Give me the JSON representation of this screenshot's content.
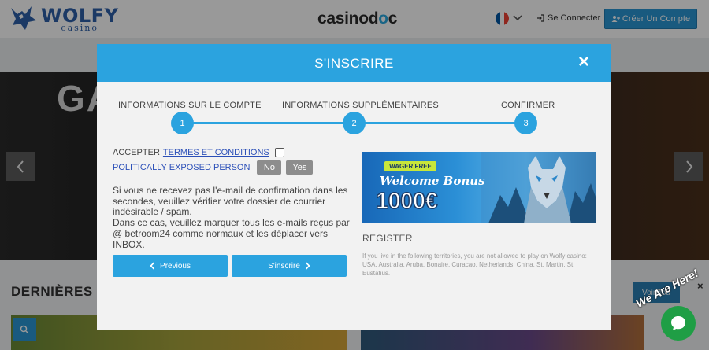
{
  "header": {
    "logo_main": "WOLFY",
    "logo_sub": "casino",
    "center_brand_left": "casino",
    "center_brand_mid": "d",
    "center_brand_dot": "o",
    "center_brand_right": "c",
    "language_flag_colors": [
      "#0055a4",
      "#ffffff",
      "#ef4135"
    ],
    "login_label": "Se Connecter",
    "register_label": "Créer Un Compte"
  },
  "background": {
    "hero_text": "GA",
    "section_title": "DERNIÈRES",
    "voir_label": "Voir Tou"
  },
  "modal": {
    "title": "S'INSCRIRE",
    "close_glyph": "×",
    "steps": [
      {
        "label": "INFORMATIONS SUR LE COMPTE",
        "number": "1"
      },
      {
        "label": "INFORMATIONS SUPPLÉMENTAIRES",
        "number": "2"
      },
      {
        "label": "CONFIRMER",
        "number": "3"
      }
    ],
    "accept_label": "ACCEPTER",
    "terms_link": "TERMES ET CONDITIONS",
    "pep_link": "POLITICALLY EXPOSED PERSON",
    "pep_no": "No",
    "pep_yes": "Yes",
    "info_text_1": "Si vous ne recevez pas l'e-mail de confirmation dans les secondes, veuillez vérifier votre dossier de courrier indésirable / spam.",
    "info_text_2": "Dans ce cas, veuillez marquer tous les e-mails reçus par @ betroom24 comme normaux et les déplacer vers INBOX.",
    "previous_label": "Previous",
    "signup_label": "S'inscrire",
    "banner": {
      "wager_label": "WAGER FREE",
      "welcome_label": "Welcome Bonus",
      "amount_label": "1000€"
    },
    "register_heading": "REGISTER",
    "restriction_text": "If you live in the following territories, you are not allowed to play on Wolfy casino: USA, Australia, Aruba, Bonaire, Curacao, Netherlands, China, St. Martin, St. Eustatius."
  },
  "widget": {
    "close_glyph": "×",
    "label": "We Are Here!"
  },
  "colors": {
    "accent": "#2ba3df",
    "brand": "#2d5fa8",
    "link": "#2b4fb8",
    "chat": "#1f9e45"
  }
}
